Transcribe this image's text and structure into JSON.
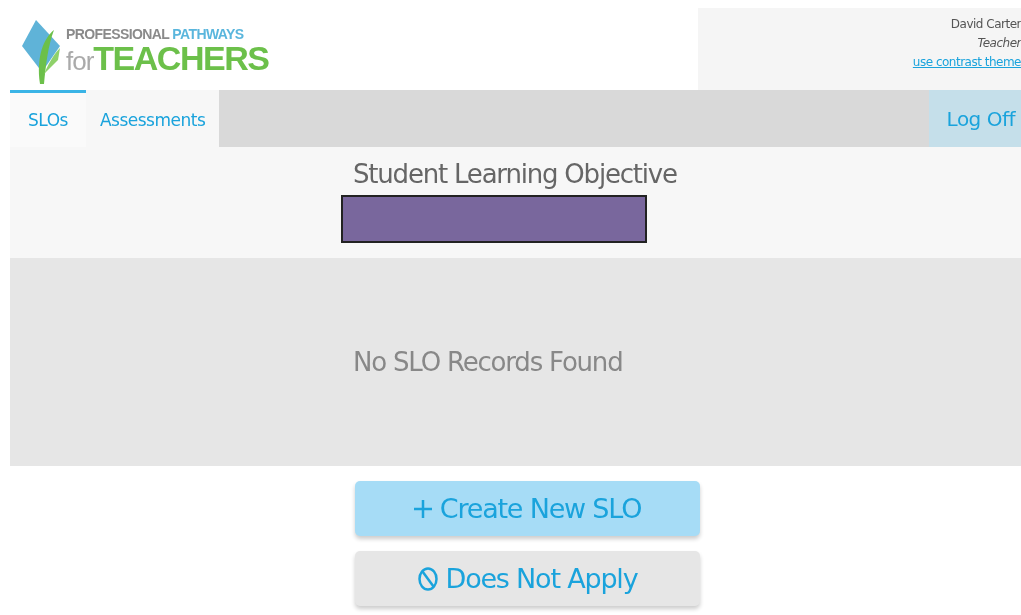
{
  "logo": {
    "line1_a": "PROFESSIONAL",
    "line1_b": "PATHWAYS",
    "line2_a": "for",
    "line2_b": "TEACHERS"
  },
  "user": {
    "name": "David Carter",
    "role": "Teacher",
    "link": "use contrast theme"
  },
  "tabs": [
    {
      "label": "SLOs",
      "selected": true
    },
    {
      "label": "Assessments",
      "selected": false
    }
  ],
  "log_off": "Log Off",
  "section": {
    "title": "Student Learning Objective"
  },
  "empty_message": "No SLO Records Found",
  "buttons": [
    {
      "label": "Create New SLO",
      "kind": "primary"
    },
    {
      "label": "Does Not Apply",
      "kind": "secondary"
    }
  ]
}
